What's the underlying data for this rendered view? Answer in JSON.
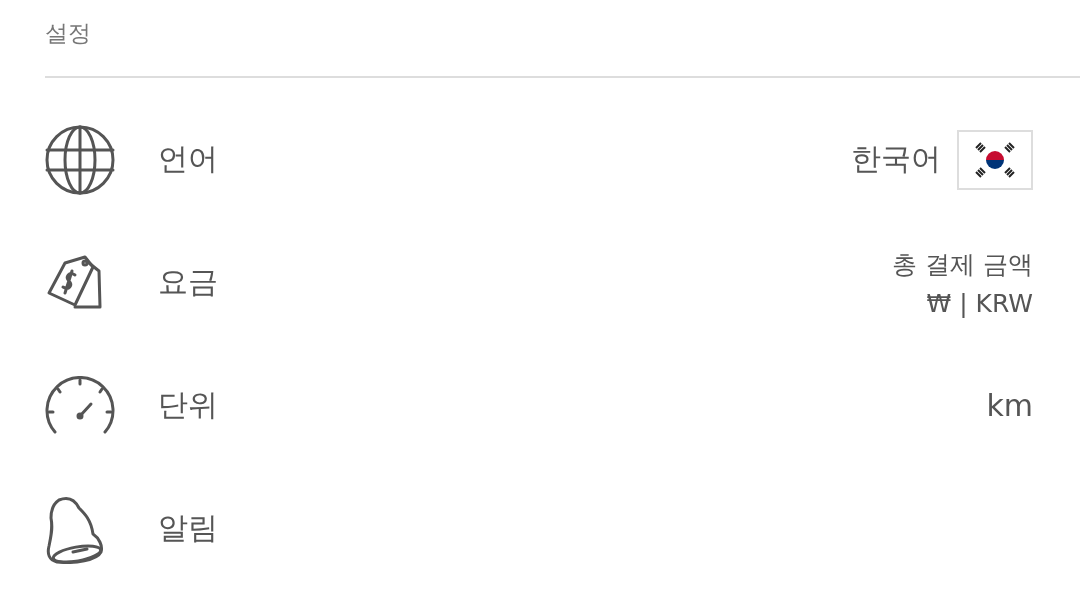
{
  "header": {
    "title": "설정"
  },
  "rows": [
    {
      "kind": "language",
      "label": "언어",
      "value": "한국어"
    },
    {
      "kind": "price",
      "label": "요금",
      "value": "총 결제 금액",
      "subvalue": "₩ | KRW"
    },
    {
      "kind": "unit",
      "label": "단위",
      "value": "km"
    },
    {
      "kind": "alerts",
      "label": "알림"
    }
  ]
}
